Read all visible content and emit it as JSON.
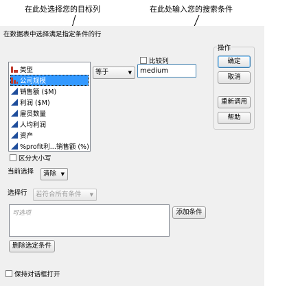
{
  "callouts": {
    "select_column": "在此处选择您的目标列",
    "enter_criteria": "在此处输入您的搜索条件"
  },
  "dialog": {
    "description": "在数据表中选择满足指定条件的行",
    "columns": [
      {
        "name": "类型",
        "icon": "nominal-bar-icon",
        "selected": false
      },
      {
        "name": "公司规模",
        "icon": "ordinal-bar-icon",
        "selected": true
      },
      {
        "name": "销售额 ($M)",
        "icon": "continuous-triangle-icon",
        "selected": false
      },
      {
        "name": "利润 ($M)",
        "icon": "continuous-triangle-icon",
        "selected": false
      },
      {
        "name": "雇员数量",
        "icon": "continuous-triangle-icon",
        "selected": false
      },
      {
        "name": "人均利润",
        "icon": "continuous-triangle-icon",
        "selected": false
      },
      {
        "name": "资产",
        "icon": "continuous-triangle-icon",
        "selected": false
      },
      {
        "name": "%profit利...销售额 (%)",
        "icon": "continuous-triangle-icon",
        "selected": false
      }
    ],
    "operator": "等于",
    "compare_column_label": "比较列",
    "search_value": "medium",
    "case_sensitive_label": "区分大小写",
    "current_selection_label": "当前选择",
    "current_selection_value": "清除",
    "select_rows_label": "选择行",
    "select_rows_value": "若符合所有条件",
    "conditions_placeholder": "可选项",
    "add_condition": "添加条件",
    "remove_condition": "删除选定条件",
    "keep_open": "保持对话框打开"
  },
  "actions": {
    "title": "操作",
    "ok": "确定",
    "cancel": "取消",
    "recall": "重新调用",
    "help": "帮助"
  },
  "colors": {
    "selection": "#3399ff",
    "nominal": "#c0392b",
    "continuous": "#1f4e9c"
  }
}
